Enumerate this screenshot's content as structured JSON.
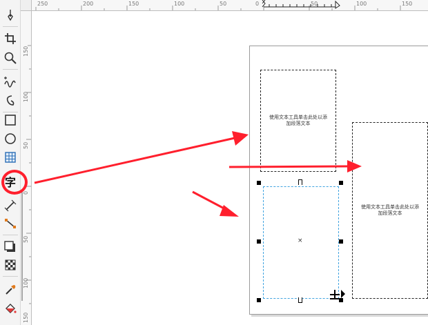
{
  "ruler_top": {
    "labels": [
      "250",
      "200",
      "150",
      "100",
      "50",
      "0",
      "50",
      "100",
      "150"
    ]
  },
  "ruler_left": {
    "labels": [
      "150",
      "100",
      "50",
      "0",
      "50",
      "100",
      "150"
    ]
  },
  "toolbox": {
    "tools": [
      {
        "name": "pick-tool",
        "icon": "pointer-icon"
      },
      {
        "name": "crop-tool",
        "icon": "crop-icon"
      },
      {
        "name": "zoom-tool",
        "icon": "magnifier-icon"
      },
      {
        "name": "freehand-tool",
        "icon": "freehand-icon"
      },
      {
        "name": "artistic-media-tool",
        "icon": "brush-curve-icon"
      },
      {
        "name": "rectangle-tool",
        "icon": "rectangle-icon"
      },
      {
        "name": "ellipse-tool",
        "icon": "ellipse-icon"
      },
      {
        "name": "table-tool",
        "icon": "table-grid-icon"
      },
      {
        "name": "text-tool",
        "icon": "text-char-icon"
      },
      {
        "name": "dimension-tool",
        "icon": "dimension-icon"
      },
      {
        "name": "connector-tool",
        "icon": "connector-icon"
      },
      {
        "name": "drop-shadow-tool",
        "icon": "drop-shadow-icon"
      },
      {
        "name": "transparency-tool",
        "icon": "checker-icon"
      },
      {
        "name": "eyedropper-tool",
        "icon": "eyedropper-icon"
      },
      {
        "name": "fill-tool",
        "icon": "paint-bucket-icon"
      }
    ],
    "text_tool_glyph": "字"
  },
  "document": {
    "frames": [
      {
        "id": "frame-1",
        "text": "使用文本工具单击此处以添加段落文本"
      },
      {
        "id": "frame-2",
        "text": "使用文本工具单击此处以添加段落文本"
      },
      {
        "id": "frame-3",
        "text": ""
      }
    ],
    "center_marker": "×"
  },
  "colors": {
    "annotation_red": "#ff1f2d",
    "selection_blue": "#3fa3e0"
  }
}
